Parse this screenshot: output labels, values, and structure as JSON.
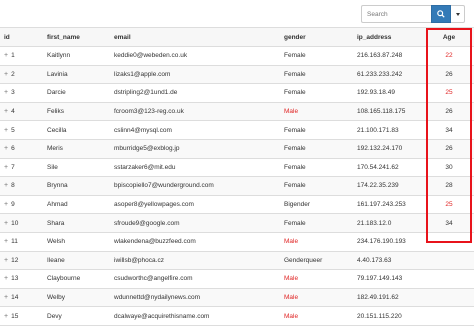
{
  "search": {
    "placeholder": "Search"
  },
  "columns": {
    "id": "id",
    "first_name": "first_name",
    "email": "email",
    "gender": "gender",
    "ip_address": "ip_address",
    "age": "Age"
  },
  "rows": [
    {
      "id": "1",
      "first_name": "Kaitlynn",
      "email": "keddie0@webeden.co.uk",
      "gender": "Female",
      "ip_address": "216.163.87.248",
      "age": "22",
      "age_red": true
    },
    {
      "id": "2",
      "first_name": "Lavinia",
      "email": "lizaks1@apple.com",
      "gender": "Female",
      "ip_address": "61.233.233.242",
      "age": "26"
    },
    {
      "id": "3",
      "first_name": "Darcie",
      "email": "dstripling2@1und1.de",
      "gender": "Female",
      "ip_address": "192.93.18.49",
      "age": "25",
      "age_red": true
    },
    {
      "id": "4",
      "first_name": "Feliks",
      "email": "fcroom3@123-reg.co.uk",
      "gender": "Male",
      "gender_red": true,
      "ip_address": "108.165.118.175",
      "age": "26"
    },
    {
      "id": "5",
      "first_name": "Cecilla",
      "email": "cslinn4@mysql.com",
      "gender": "Female",
      "ip_address": "21.100.171.83",
      "age": "34"
    },
    {
      "id": "6",
      "first_name": "Meris",
      "email": "mburridge5@exblog.jp",
      "gender": "Female",
      "ip_address": "192.132.24.170",
      "age": "26"
    },
    {
      "id": "7",
      "first_name": "Sile",
      "email": "sstarzaker6@mit.edu",
      "gender": "Female",
      "ip_address": "170.54.241.62",
      "age": "30"
    },
    {
      "id": "8",
      "first_name": "Brynna",
      "email": "bpiscopiello7@wunderground.com",
      "gender": "Female",
      "ip_address": "174.22.35.239",
      "age": "28"
    },
    {
      "id": "9",
      "first_name": "Ahmad",
      "email": "asoper8@yellowpages.com",
      "gender": "Bigender",
      "ip_address": "161.197.243.253",
      "age": "25",
      "age_red": true
    },
    {
      "id": "10",
      "first_name": "Shara",
      "email": "sfroude9@google.com",
      "gender": "Female",
      "ip_address": "21.183.12.0",
      "age": "34"
    },
    {
      "id": "11",
      "first_name": "Welsh",
      "email": "wlakendena@buzzfeed.com",
      "gender": "Male",
      "gender_red": true,
      "ip_address": "234.176.190.193",
      "age": ""
    },
    {
      "id": "12",
      "first_name": "Ileane",
      "email": "iwillsb@phoca.cz",
      "gender": "Genderqueer",
      "ip_address": "4.40.173.63",
      "age": ""
    },
    {
      "id": "13",
      "first_name": "Claybourne",
      "email": "csudworthc@angelfire.com",
      "gender": "Male",
      "gender_red": true,
      "ip_address": "79.197.149.143",
      "age": ""
    },
    {
      "id": "14",
      "first_name": "Welby",
      "email": "wdunnettd@nydailynews.com",
      "gender": "Male",
      "gender_red": true,
      "ip_address": "182.49.191.62",
      "age": ""
    },
    {
      "id": "15",
      "first_name": "Devy",
      "email": "dcalwaye@acquirethisname.com",
      "gender": "Male",
      "gender_red": true,
      "ip_address": "20.151.115.220",
      "age": ""
    }
  ],
  "colors": {
    "accent": "#337ab7",
    "highlight": "#e8131b",
    "red_text": "#e02424"
  },
  "icons": {
    "search": "search-icon",
    "dropdown": "caret-down-icon",
    "expand": "plus-icon"
  }
}
